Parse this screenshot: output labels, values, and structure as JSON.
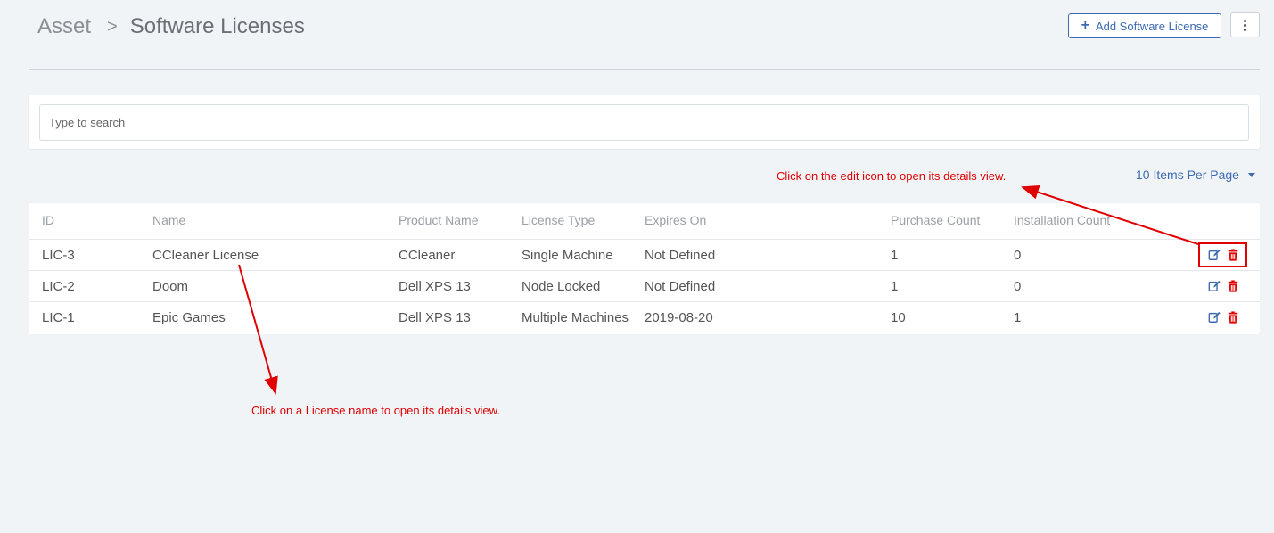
{
  "breadcrumb": {
    "root": "Asset",
    "separator": ">",
    "current": "Software Licenses"
  },
  "toolbar": {
    "add_label": "Add Software License",
    "add_icon": "plus-icon",
    "more_icon": "kebab-menu-icon"
  },
  "search": {
    "placeholder": "Type to search",
    "value": ""
  },
  "pagination": {
    "per_page_label": "10 Items Per Page"
  },
  "table": {
    "headers": {
      "id": "ID",
      "name": "Name",
      "product": "Product Name",
      "license_type": "License Type",
      "expires": "Expires On",
      "purchase": "Purchase Count",
      "installation": "Installation Count"
    },
    "rows": [
      {
        "id": "LIC-3",
        "name": "CCleaner License",
        "product": "CCleaner",
        "license_type": "Single Machine",
        "expires": "Not Defined",
        "purchase": "1",
        "installation": "0"
      },
      {
        "id": "LIC-2",
        "name": "Doom",
        "product": "Dell XPS 13",
        "license_type": "Node Locked",
        "expires": "Not Defined",
        "purchase": "1",
        "installation": "0"
      },
      {
        "id": "LIC-1",
        "name": "Epic Games",
        "product": "Dell XPS 13",
        "license_type": "Multiple Machines",
        "expires": "2019-08-20",
        "purchase": "10",
        "installation": "1"
      }
    ]
  },
  "annotations": {
    "edit_hint": "Click on the edit icon to open its details view.",
    "name_hint": "Click on a License name to open its details view."
  },
  "colors": {
    "accent": "#3d6bb3",
    "delete": "#e00000",
    "annotation": "#e00000",
    "background": "#f0f4f7"
  }
}
